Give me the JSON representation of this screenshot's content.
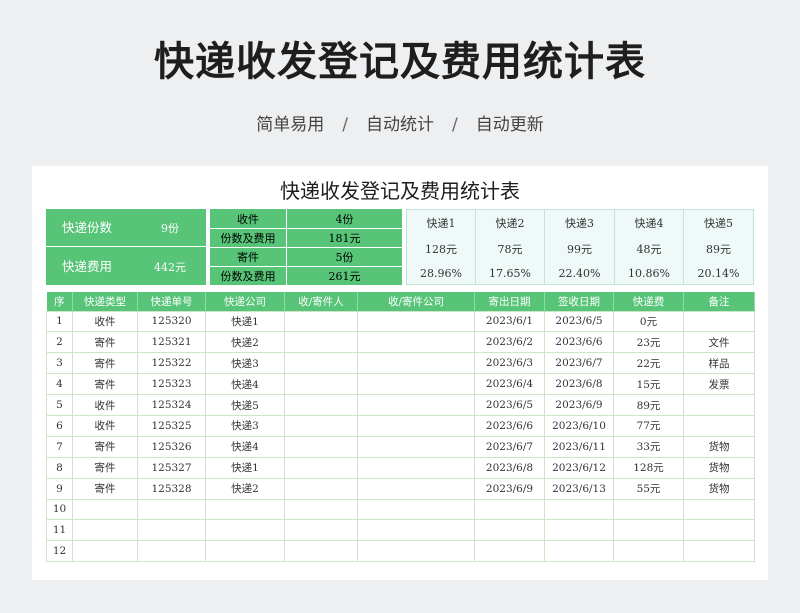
{
  "header": {
    "title": "快递收发登记及费用统计表",
    "features": [
      "简单易用",
      "自动统计",
      "自动更新"
    ],
    "separator": "/"
  },
  "sheet": {
    "title": "快递收发登记及费用统计表",
    "summary": {
      "count_label": "快递份数",
      "count_value": "9份",
      "fee_label": "快递费用",
      "fee_value": "442元",
      "receive_label": "收件",
      "receive_count": "4份",
      "receive_fee_label": "份数及费用",
      "receive_fee": "181元",
      "send_label": "寄件",
      "send_count": "5份",
      "send_fee_label": "份数及费用",
      "send_fee": "261元"
    },
    "couriers": [
      {
        "name": "快递1",
        "fee": "128元",
        "pct": "28.96%"
      },
      {
        "name": "快递2",
        "fee": "78元",
        "pct": "17.65%"
      },
      {
        "name": "快递3",
        "fee": "99元",
        "pct": "22.40%"
      },
      {
        "name": "快递4",
        "fee": "48元",
        "pct": "10.86%"
      },
      {
        "name": "快递5",
        "fee": "89元",
        "pct": "20.14%"
      }
    ],
    "columns": [
      "序",
      "快递类型",
      "快递单号",
      "快递公司",
      "收/寄件人",
      "收/寄件公司",
      "寄出日期",
      "签收日期",
      "快递费",
      "备注"
    ],
    "rows": [
      [
        "1",
        "收件",
        "125320",
        "快递1",
        "",
        "",
        "2023/6/1",
        "2023/6/5",
        "0元",
        ""
      ],
      [
        "2",
        "寄件",
        "125321",
        "快递2",
        "",
        "",
        "2023/6/2",
        "2023/6/6",
        "23元",
        "文件"
      ],
      [
        "3",
        "寄件",
        "125322",
        "快递3",
        "",
        "",
        "2023/6/3",
        "2023/6/7",
        "22元",
        "样品"
      ],
      [
        "4",
        "寄件",
        "125323",
        "快递4",
        "",
        "",
        "2023/6/4",
        "2023/6/8",
        "15元",
        "发票"
      ],
      [
        "5",
        "收件",
        "125324",
        "快递5",
        "",
        "",
        "2023/6/5",
        "2023/6/9",
        "89元",
        ""
      ],
      [
        "6",
        "收件",
        "125325",
        "快递3",
        "",
        "",
        "2023/6/6",
        "2023/6/10",
        "77元",
        ""
      ],
      [
        "7",
        "寄件",
        "125326",
        "快递4",
        "",
        "",
        "2023/6/7",
        "2023/6/11",
        "33元",
        "货物"
      ],
      [
        "8",
        "寄件",
        "125327",
        "快递1",
        "",
        "",
        "2023/6/8",
        "2023/6/12",
        "128元",
        "货物"
      ],
      [
        "9",
        "寄件",
        "125328",
        "快递2",
        "",
        "",
        "2023/6/9",
        "2023/6/13",
        "55元",
        "货物"
      ],
      [
        "10",
        "",
        "",
        "",
        "",
        "",
        "",
        "",
        "",
        ""
      ],
      [
        "11",
        "",
        "",
        "",
        "",
        "",
        "",
        "",
        "",
        ""
      ],
      [
        "12",
        "",
        "",
        "",
        "",
        "",
        "",
        "",
        "",
        ""
      ]
    ]
  },
  "colors": {
    "accent": "#57c478",
    "courier_bg": "#eef9f8",
    "grid": "#cde6c8"
  }
}
